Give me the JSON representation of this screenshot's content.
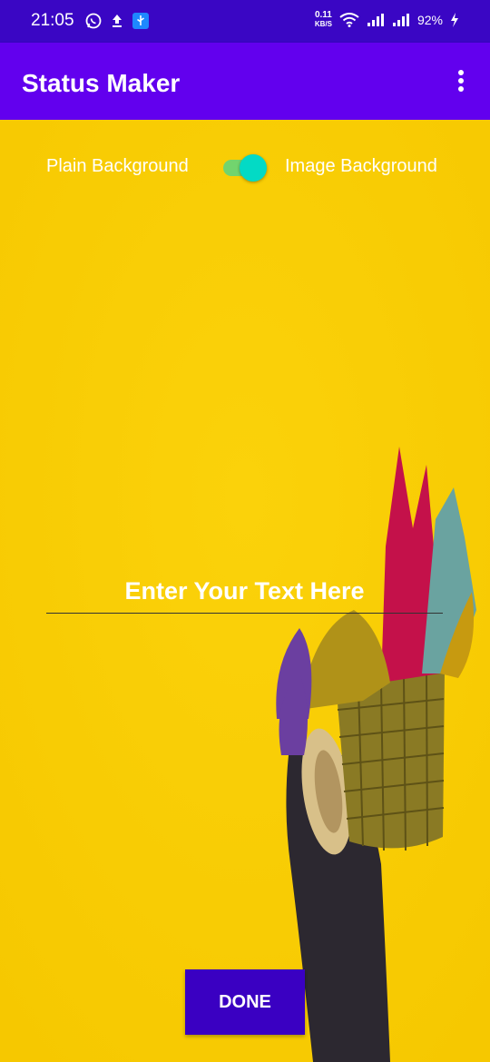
{
  "status_bar": {
    "time": "21:05",
    "net_speed": "0.11",
    "net_unit": "KB/S",
    "battery": "92%"
  },
  "app_bar": {
    "title": "Status Maker"
  },
  "toggle": {
    "left_label": "Plain Background",
    "right_label": "Image Background",
    "checked": true
  },
  "text_input": {
    "placeholder": "Enter Your Text Here"
  },
  "done_button": {
    "label": "DONE"
  },
  "colors": {
    "status_bar": "#3a06c4",
    "app_bar": "#6200ee",
    "accent": "#03dac5",
    "background": "#f9cd07",
    "button": "#3a00c2"
  }
}
